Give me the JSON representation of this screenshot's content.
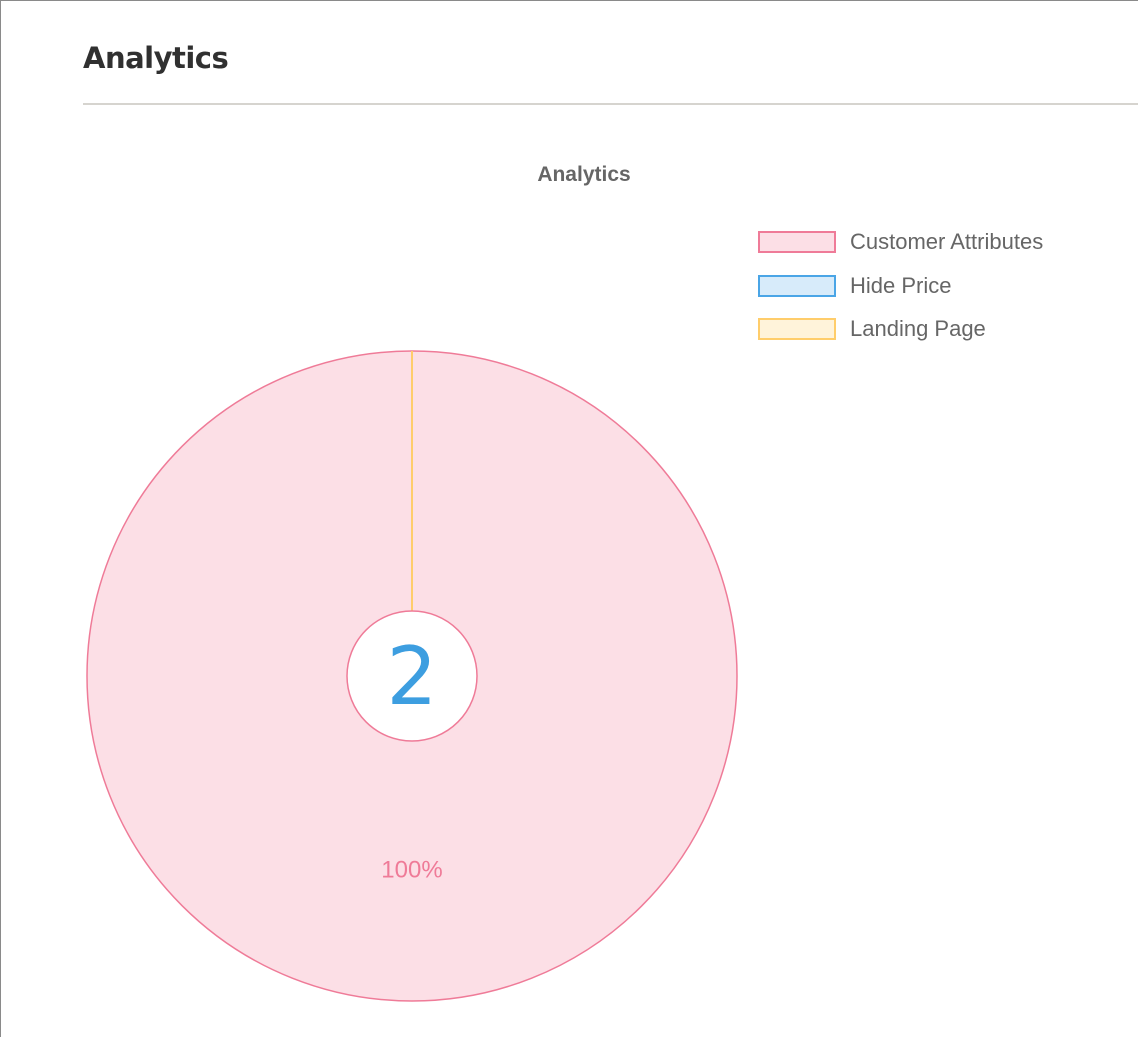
{
  "panel": {
    "title": "Analytics"
  },
  "colors": {
    "customer_attributes_fill": "#fcdfe6",
    "customer_attributes_border": "#ef7b98",
    "hide_price_fill": "#d7ebfa",
    "hide_price_border": "#4aa5e6",
    "landing_page_fill": "#fff3da",
    "landing_page_border": "#ffcd6b",
    "center_value_color": "#3d9ee0"
  },
  "chart_data": {
    "type": "pie",
    "title": "Analytics",
    "categories": [
      "Customer Attributes",
      "Hide Price",
      "Landing Page"
    ],
    "values": [
      2,
      0,
      0
    ],
    "percent_labels": [
      "100%",
      "",
      ""
    ],
    "center_value": "2",
    "legend_position": "top-right"
  }
}
